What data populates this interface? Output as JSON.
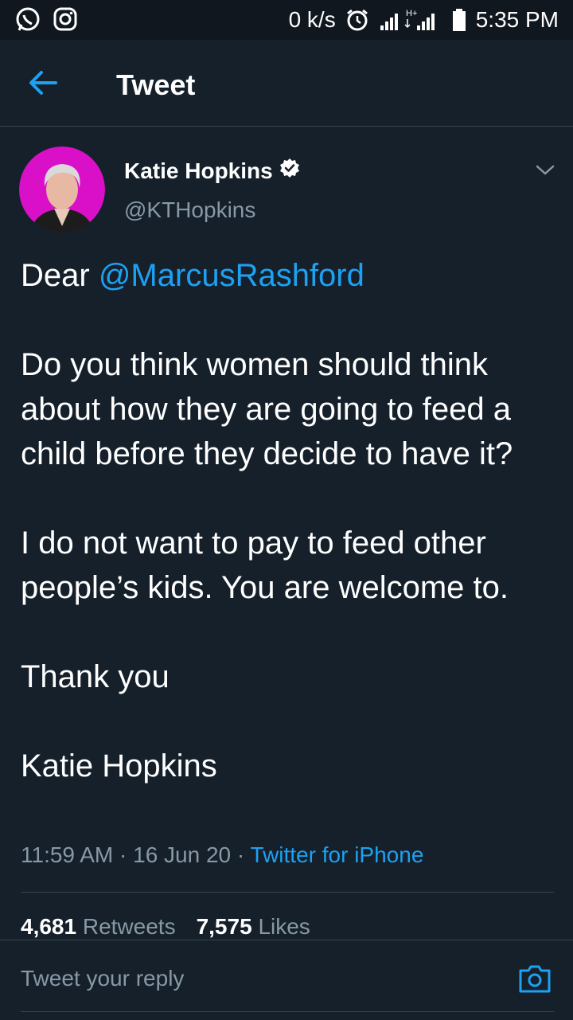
{
  "status_bar": {
    "speed": "0 k/s",
    "time": "5:35 PM",
    "network": "H+"
  },
  "app_bar": {
    "title": "Tweet"
  },
  "tweet": {
    "author_name": "Katie Hopkins",
    "author_handle": "@KTHopkins",
    "verified": true,
    "greeting": "Dear",
    "mention": "@MarcusRashford",
    "paragraph_1": "Do you think women should think about how they are going to feed a child before they decide to have it?",
    "paragraph_2": "I do not want to pay to feed other people’s kids. You are welcome to.",
    "paragraph_3": "Thank you",
    "paragraph_4": "Katie Hopkins",
    "time": "11:59 AM",
    "date": "16 Jun 20",
    "source": "Twitter for iPhone",
    "retweet_count": "4,681",
    "retweet_label": "Retweets",
    "like_count": "7,575",
    "like_label": "Likes"
  },
  "reply": {
    "placeholder": "Tweet your reply"
  },
  "colors": {
    "background": "#15202b",
    "accent": "#1da1f2",
    "secondary_text": "#8899a6",
    "divider": "#38444d"
  }
}
